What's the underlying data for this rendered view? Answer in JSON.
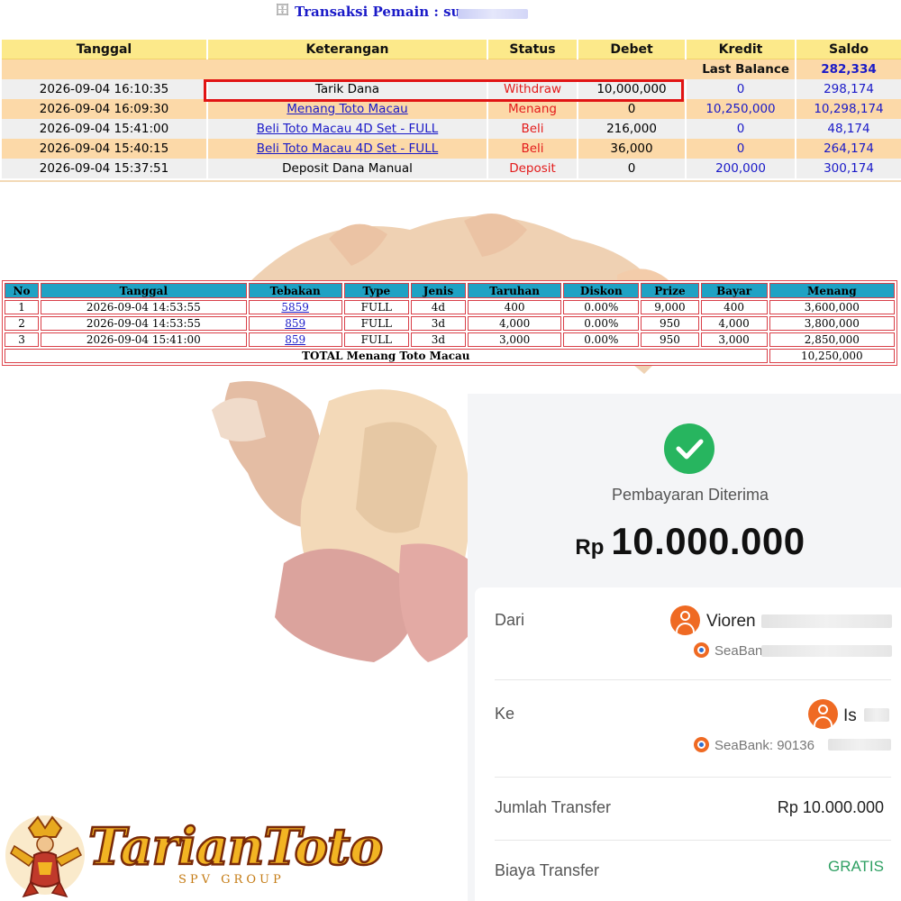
{
  "header": {
    "icon": "document-icon",
    "title": "Transaksi   Pemain : su"
  },
  "transactions": {
    "columns": [
      "Tanggal",
      "Keterangan",
      "Status",
      "Debet",
      "Kredit",
      "Saldo"
    ],
    "last_balance_label": "Last Balance",
    "last_balance_value": "282,334",
    "rows": [
      {
        "tanggal": "2026-09-04 16:10:35",
        "keterangan": "Tarik Dana",
        "status": "Withdraw",
        "debet": "10,000,000",
        "kredit": "0",
        "saldo": "298,174"
      },
      {
        "tanggal": "2026-09-04 16:09:30",
        "keterangan": "Menang Toto Macau",
        "status": "Menang",
        "debet": "0",
        "kredit": "10,250,000",
        "saldo": "10,298,174"
      },
      {
        "tanggal": "2026-09-04 15:41:00",
        "keterangan": "Beli Toto Macau 4D Set - FULL",
        "status": "Beli",
        "debet": "216,000",
        "kredit": "0",
        "saldo": "48,174"
      },
      {
        "tanggal": "2026-09-04 15:40:15",
        "keterangan": "Beli Toto Macau 4D Set - FULL",
        "status": "Beli",
        "debet": "36,000",
        "kredit": "0",
        "saldo": "264,174"
      },
      {
        "tanggal": "2026-09-04 15:37:51",
        "keterangan": "Deposit Dana Manual",
        "status": "Deposit",
        "debet": "0",
        "kredit": "200,000",
        "saldo": "300,174"
      }
    ]
  },
  "bets": {
    "columns": [
      "No",
      "Tanggal",
      "Tebakan",
      "Type",
      "Jenis",
      "Taruhan",
      "Diskon",
      "Prize",
      "Bayar",
      "Menang"
    ],
    "rows": [
      {
        "no": "1",
        "tanggal": "2026-09-04 14:53:55",
        "tebakan": "5859",
        "type": "FULL",
        "jenis": "4d",
        "taruhan": "400",
        "diskon": "0.00%",
        "prize": "9,000",
        "bayar": "400",
        "menang": "3,600,000"
      },
      {
        "no": "2",
        "tanggal": "2026-09-04 14:53:55",
        "tebakan": "859",
        "type": "FULL",
        "jenis": "3d",
        "taruhan": "4,000",
        "diskon": "0.00%",
        "prize": "950",
        "bayar": "4,000",
        "menang": "3,800,000"
      },
      {
        "no": "3",
        "tanggal": "2026-09-04 15:41:00",
        "tebakan": "859",
        "type": "FULL",
        "jenis": "3d",
        "taruhan": "3,000",
        "diskon": "0.00%",
        "prize": "950",
        "bayar": "3,000",
        "menang": "2,850,000"
      }
    ],
    "total_label": "TOTAL  Menang Toto Macau",
    "total_value": "10,250,000"
  },
  "payment": {
    "status_icon": "check-icon",
    "status_text": "Pembayaran Diterima",
    "currency": "Rp",
    "amount": "10.000.000",
    "from_label": "Dari",
    "from_name": "Vioren",
    "from_bank": "SeaBan",
    "to_label": "Ke",
    "to_name": "Is",
    "to_bank": "SeaBank: 90136",
    "jumlah_label": "Jumlah Transfer",
    "jumlah_value": "Rp 10.000.000",
    "biaya_label": "Biaya Transfer",
    "biaya_value": "GRATIS",
    "success_color": "#27b55f",
    "accent_color": "#ef6a23"
  },
  "logo": {
    "name": "TarianToto",
    "sub": "SPV GROUP"
  },
  "colors": {
    "header_yellow": "#fce98a",
    "row_orange": "#fcd9a8",
    "row_gray": "#efefef",
    "link_blue": "#1a1ac8",
    "status_red": "#e31b1b",
    "bet_header": "#1fa2c4"
  }
}
